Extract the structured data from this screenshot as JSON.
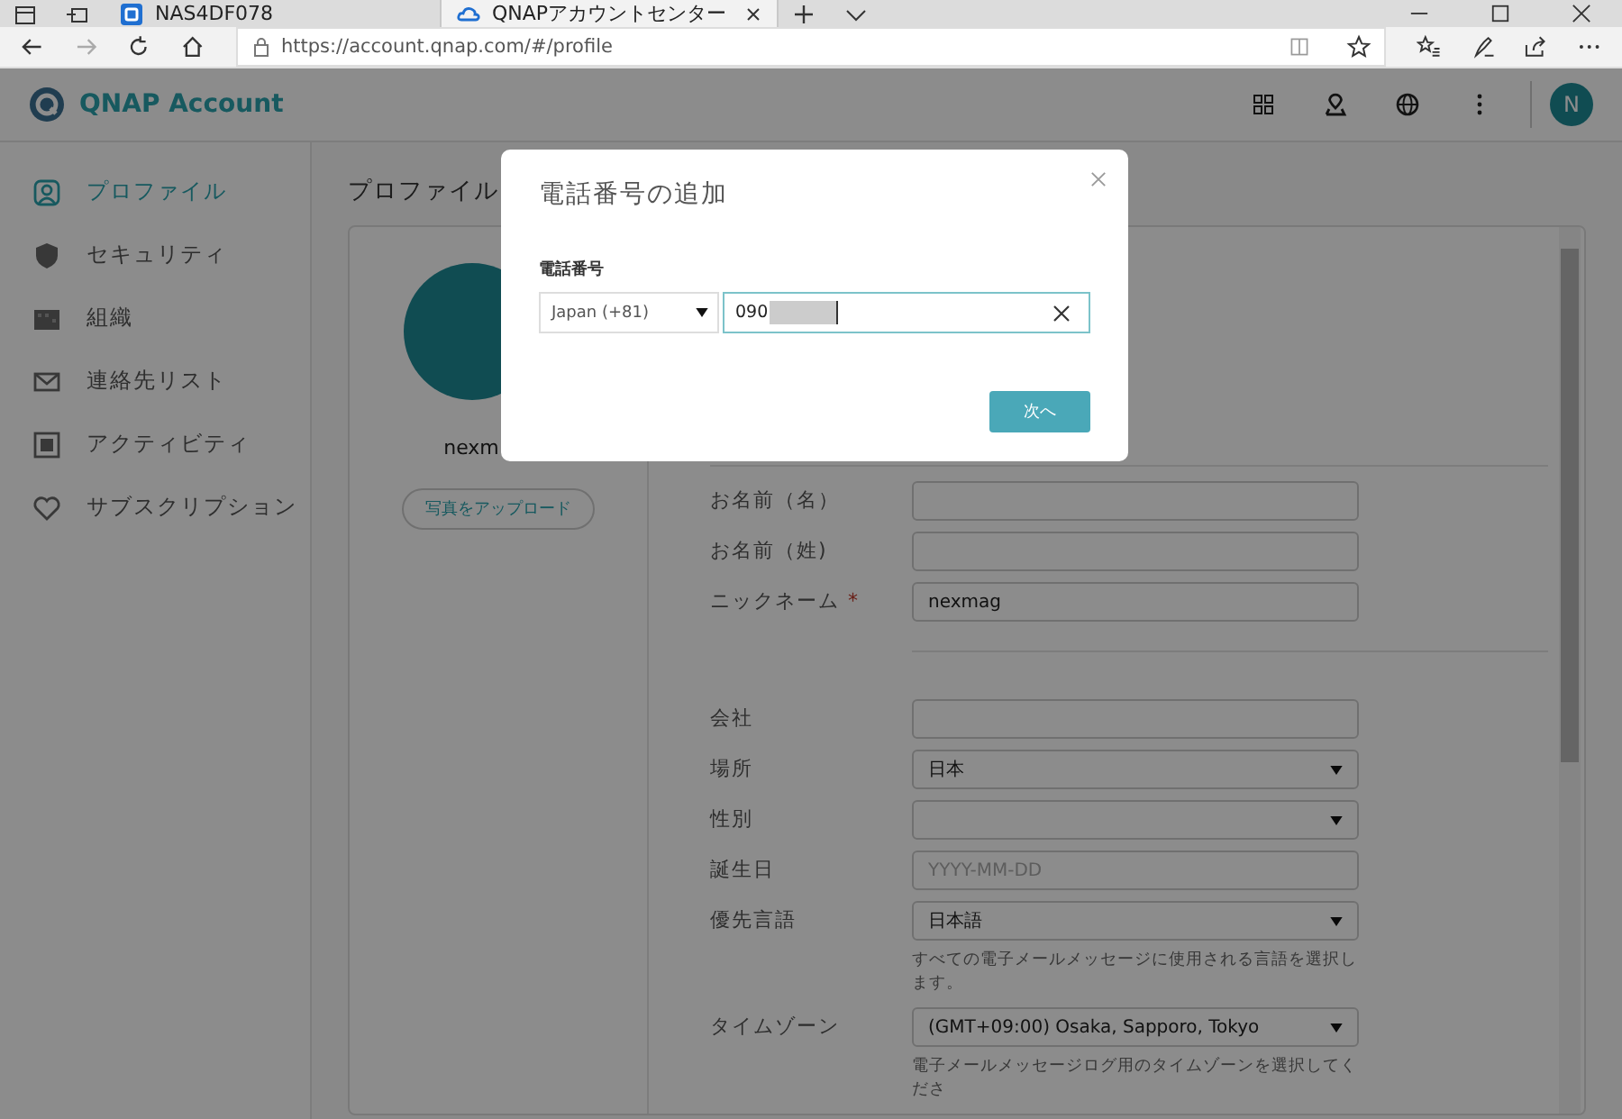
{
  "browser": {
    "tabs": [
      {
        "title": "NAS4DF078",
        "selected": false
      },
      {
        "title": "QNAPアカウントセンター",
        "selected": true
      }
    ],
    "address": "https://account.qnap.com/#/profile"
  },
  "header": {
    "logo": "QNAP Account",
    "avatar": "N"
  },
  "sidebar": {
    "items": [
      {
        "label": "プロファイル",
        "selected": true
      },
      {
        "label": "セキュリティ",
        "selected": false
      },
      {
        "label": "組織",
        "selected": false
      },
      {
        "label": "連絡先リスト",
        "selected": false
      },
      {
        "label": "アクティビティ",
        "selected": false
      },
      {
        "label": "サブスクリプション",
        "selected": false
      }
    ]
  },
  "page_title": "プロファイル",
  "profile": {
    "name": "nexm",
    "upload_button": "写真をアップロード"
  },
  "form": [
    {
      "label": "お名前（名）",
      "kind": "text"
    },
    {
      "label": "お名前（姓)",
      "kind": "text"
    },
    {
      "label": "ニックネーム",
      "required_mark": "*",
      "kind": "text",
      "value": "nexmag"
    },
    {
      "kind": "divider"
    },
    {
      "label": "会社",
      "kind": "text"
    },
    {
      "label": "場所",
      "kind": "select",
      "value": "日本"
    },
    {
      "label": "性別",
      "kind": "select"
    },
    {
      "label": "誕生日",
      "kind": "text",
      "placeholder": "YYYY-MM-DD"
    },
    {
      "label": "優先言語",
      "kind": "select",
      "value": "日本語",
      "help": "すべての電子メールメッセージに使用される言語を選択します。"
    },
    {
      "label": "タイムゾーン",
      "kind": "select",
      "value": "(GMT+09:00) Osaka, Sapporo, Tokyo",
      "help": "電子メールメッセージログ用のタイムゾーンを選択してくださ"
    }
  ],
  "modal": {
    "title": "電話番号の追加",
    "field_label": "電話番号",
    "country": "Japan (+81)",
    "phone": "090",
    "next_button": "次へ"
  }
}
